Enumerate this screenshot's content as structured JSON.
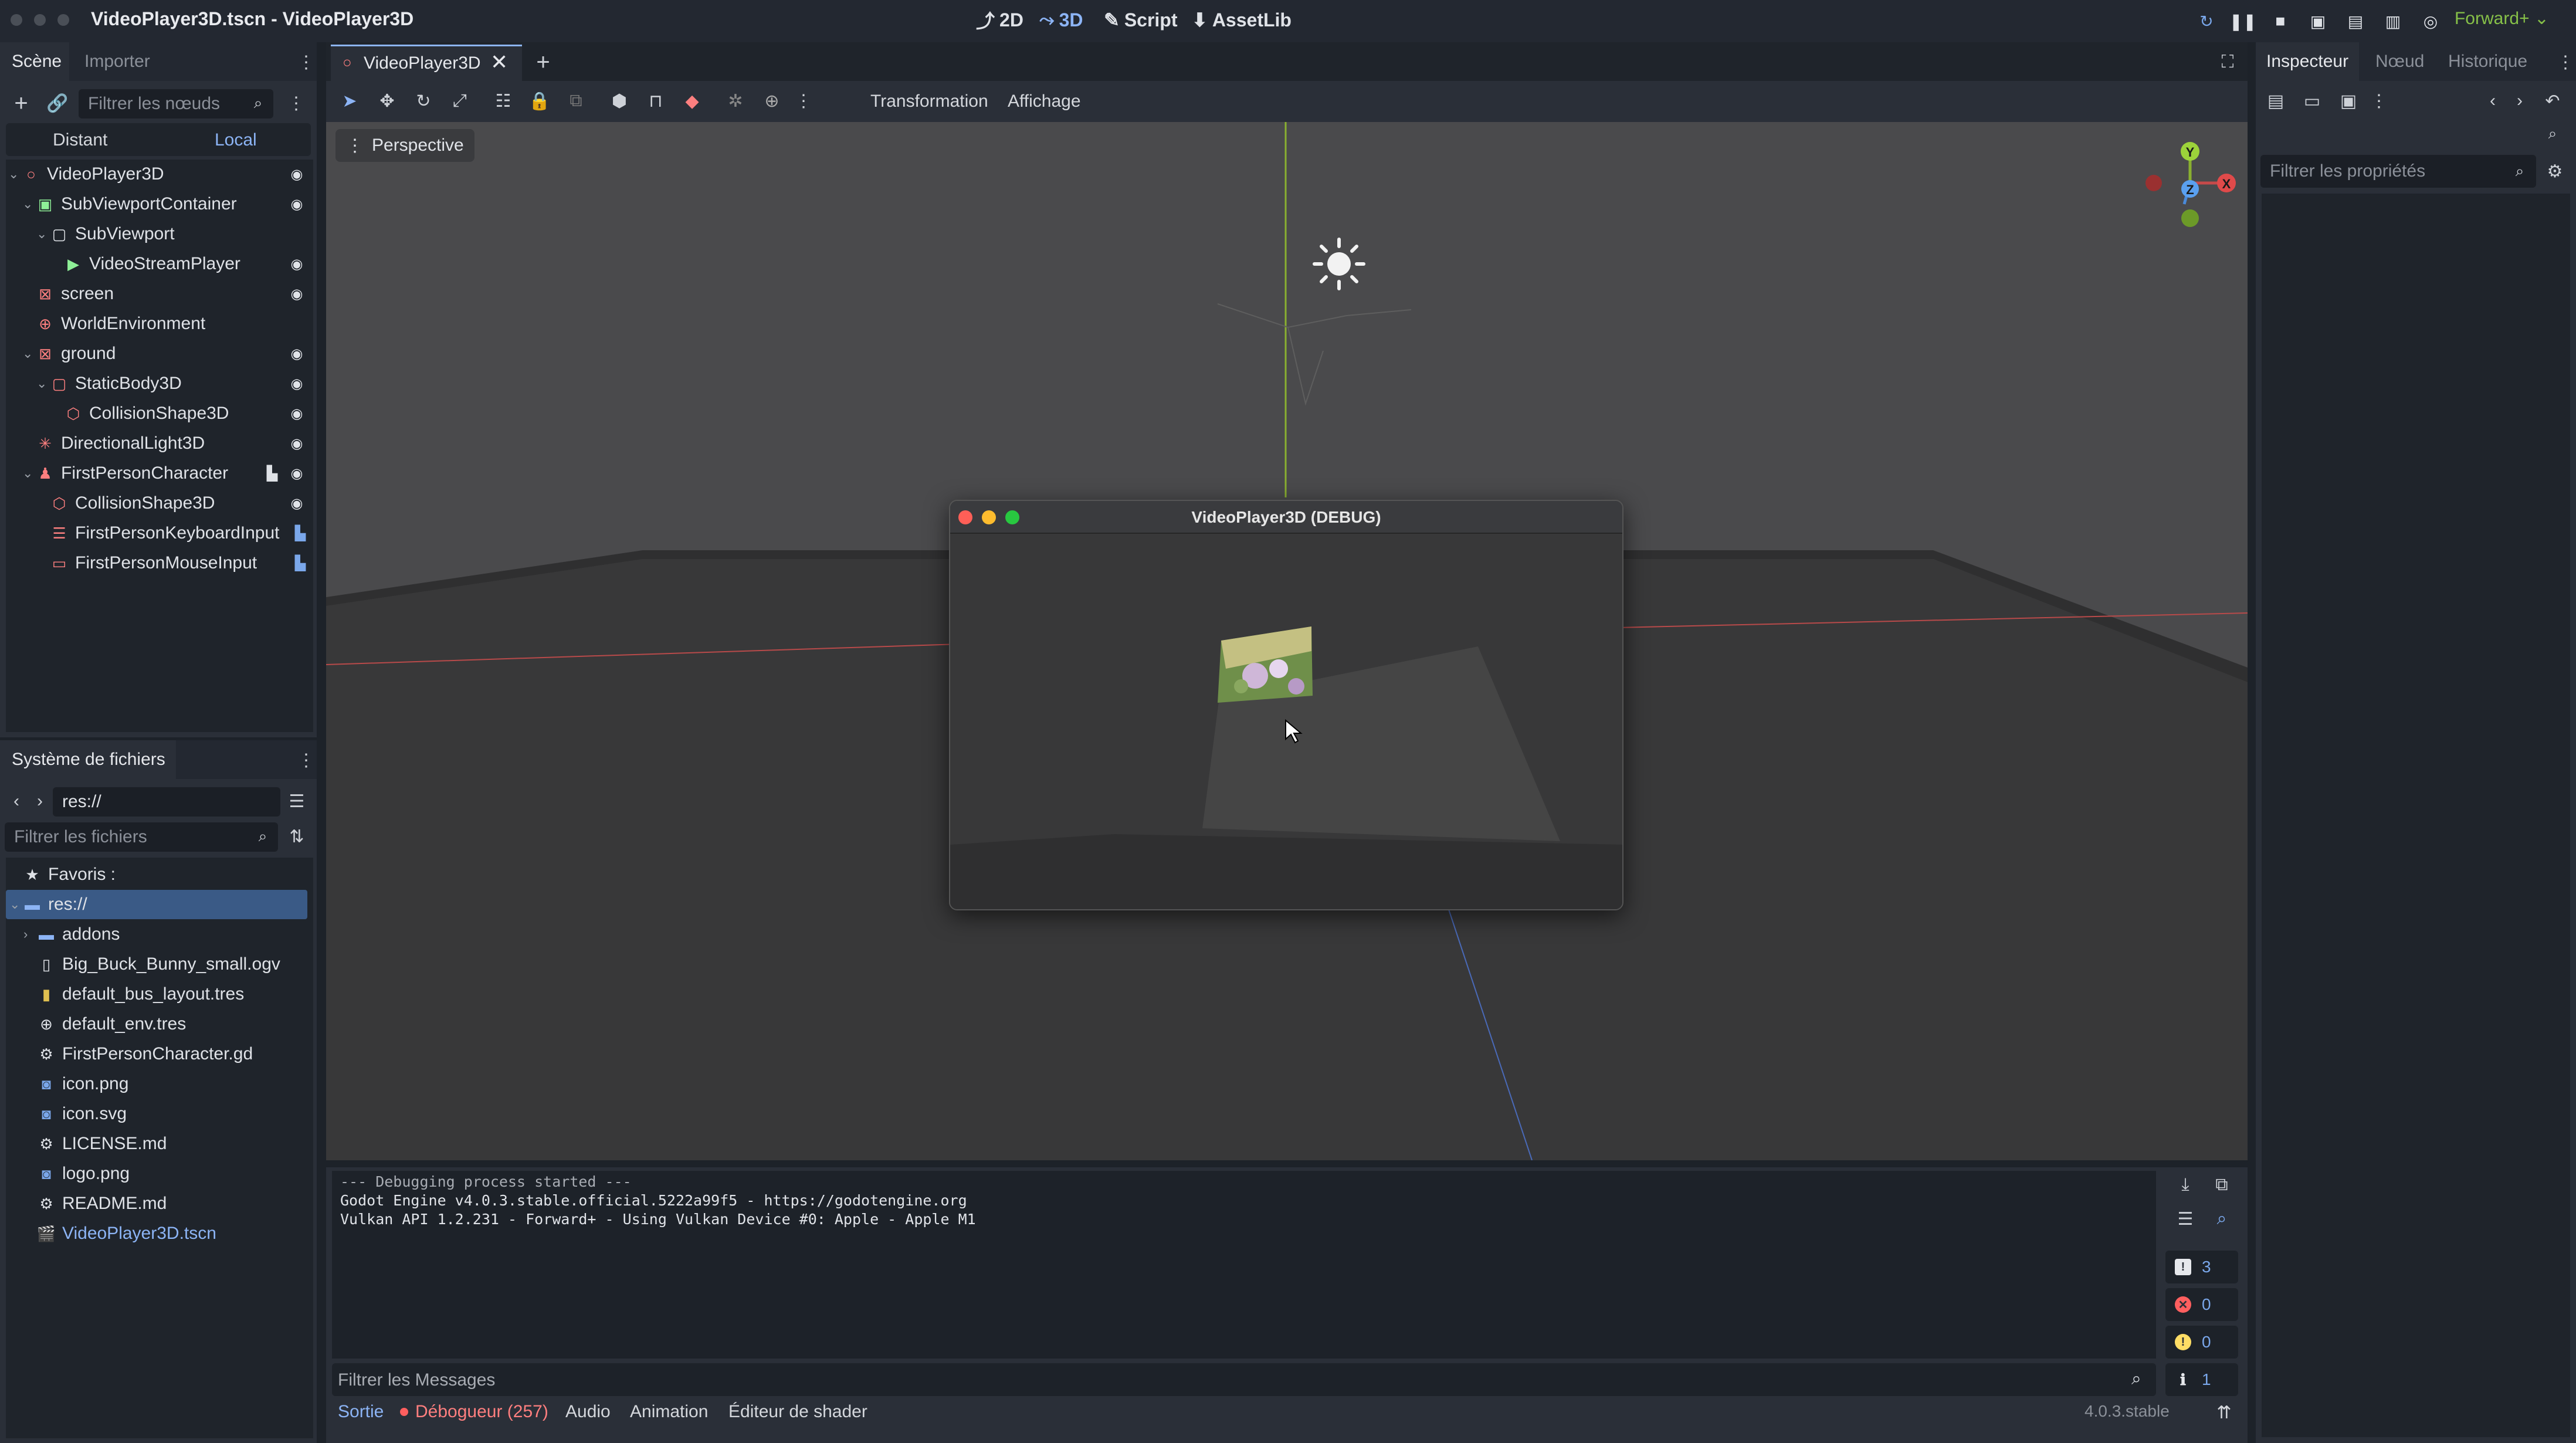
{
  "window": {
    "title": "VideoPlayer3D.tscn - VideoPlayer3D",
    "renderer": "Forward+ ⌄"
  },
  "main_modes": [
    {
      "label": "2D",
      "icon": "2d-icon"
    },
    {
      "label": "3D",
      "icon": "3d-icon"
    },
    {
      "label": "Script",
      "icon": "script-icon"
    },
    {
      "label": "AssetLib",
      "icon": "assetlib-icon"
    }
  ],
  "scene_dock": {
    "tabs": [
      "Scène",
      "Importer"
    ],
    "filter_placeholder": "Filtrer les nœuds",
    "remote_label": "Distant",
    "local_label": "Local",
    "nodes": [
      {
        "label": "VideoPlayer3D"
      },
      {
        "label": "SubViewportContainer"
      },
      {
        "label": "SubViewport"
      },
      {
        "label": "VideoStreamPlayer"
      },
      {
        "label": "screen"
      },
      {
        "label": "WorldEnvironment"
      },
      {
        "label": "ground"
      },
      {
        "label": "StaticBody3D"
      },
      {
        "label": "CollisionShape3D"
      },
      {
        "label": "DirectionalLight3D"
      },
      {
        "label": "FirstPersonCharacter"
      },
      {
        "label": "CollisionShape3D"
      },
      {
        "label": "FirstPersonKeyboardInput"
      },
      {
        "label": "FirstPersonMouseInput"
      }
    ]
  },
  "filesystem_dock": {
    "tab": "Système de fichiers",
    "path": "res://",
    "filter_placeholder": "Filtrer les fichiers",
    "favorites_label": "Favoris :",
    "root_label": "res://",
    "files": [
      {
        "label": "addons"
      },
      {
        "label": "Big_Buck_Bunny_small.ogv"
      },
      {
        "label": "default_bus_layout.tres"
      },
      {
        "label": "default_env.tres"
      },
      {
        "label": "FirstPersonCharacter.gd"
      },
      {
        "label": "icon.png"
      },
      {
        "label": "icon.svg"
      },
      {
        "label": "LICENSE.md"
      },
      {
        "label": "logo.png"
      },
      {
        "label": "README.md"
      },
      {
        "label": "VideoPlayer3D.tscn"
      }
    ]
  },
  "editor": {
    "scene_tab": "VideoPlayer3D",
    "toolbar_menus": {
      "transform": "Transformation",
      "view": "Affichage"
    },
    "viewport_label": "Perspective",
    "gizmo": {
      "y": "Y",
      "z": "Z",
      "x": "X"
    }
  },
  "debug_window": {
    "title": "VideoPlayer3D (DEBUG)"
  },
  "output": {
    "lines": [
      "--- Debugging process started ---",
      "Godot Engine v4.0.3.stable.official.5222a99f5 - https://godotengine.org",
      "Vulkan API 1.2.231 - Forward+ - Using Vulkan Device #0: Apple - Apple M1"
    ],
    "filter_placeholder": "Filtrer les Messages",
    "counters": {
      "messages": "3",
      "errors": "0",
      "warnings": "0",
      "info": "1"
    }
  },
  "bottom_tabs": {
    "output": "Sortie",
    "debugger": "Débogueur (257)",
    "audio": "Audio",
    "animation": "Animation",
    "shader_editor": "Éditeur de shader",
    "version": "4.0.3.stable"
  },
  "inspector": {
    "tabs": [
      "Inspecteur",
      "Nœud",
      "Historique"
    ],
    "filter_placeholder": "Filtrer les propriétés"
  },
  "colors": {
    "accent": "#8cb4f5",
    "renderer": "#86c048",
    "node_red": "#fc7f7f",
    "node_green": "#8eef97",
    "error": "#ff5f5f",
    "warning": "#ffdd65"
  }
}
